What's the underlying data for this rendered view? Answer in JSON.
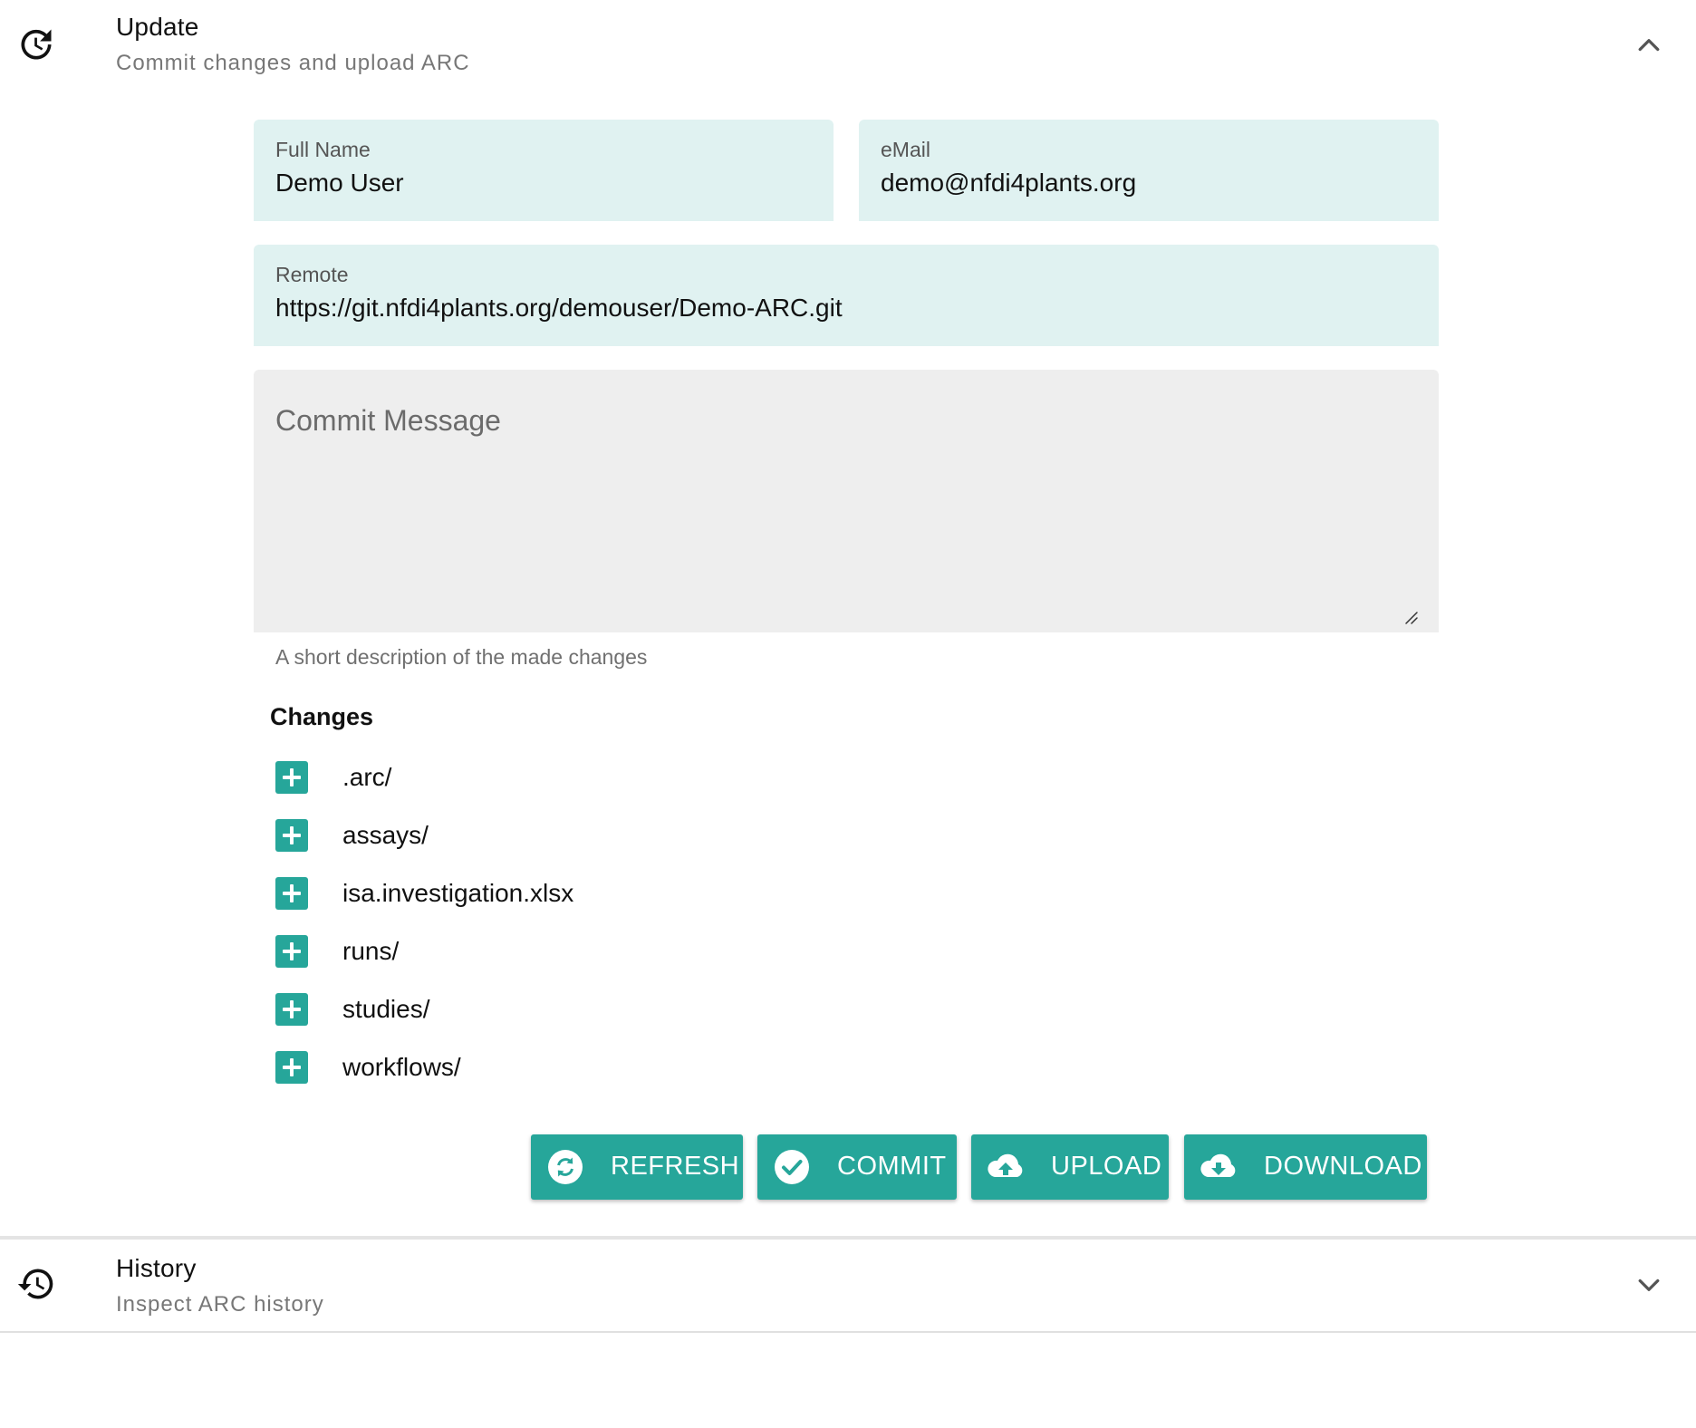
{
  "update": {
    "title": "Update",
    "subtitle": "Commit changes and upload ARC",
    "icon": "update-icon",
    "expanded": true
  },
  "form": {
    "full_name": {
      "label": "Full Name",
      "value": "Demo User"
    },
    "email": {
      "label": "eMail",
      "value": "demo@nfdi4plants.org"
    },
    "remote": {
      "label": "Remote",
      "value": "https://git.nfdi4plants.org/demouser/Demo-ARC.git"
    },
    "commit_message": {
      "placeholder": "Commit Message",
      "value": "",
      "hint": "A short description of the made changes"
    }
  },
  "changes": {
    "heading": "Changes",
    "items": [
      {
        "label": ".arc/",
        "status": "added"
      },
      {
        "label": "assays/",
        "status": "added"
      },
      {
        "label": "isa.investigation.xlsx",
        "status": "added"
      },
      {
        "label": "runs/",
        "status": "added"
      },
      {
        "label": "studies/",
        "status": "added"
      },
      {
        "label": "workflows/",
        "status": "added"
      }
    ]
  },
  "actions": {
    "refresh": "REFRESH",
    "commit": "COMMIT",
    "upload": "UPLOAD",
    "download": "DOWNLOAD"
  },
  "history": {
    "title": "History",
    "subtitle": "Inspect ARC history",
    "icon": "history-icon",
    "expanded": false
  },
  "colors": {
    "accent": "#26a69a",
    "field_background": "#e0f2f1",
    "textarea_background": "#eeeeee"
  }
}
